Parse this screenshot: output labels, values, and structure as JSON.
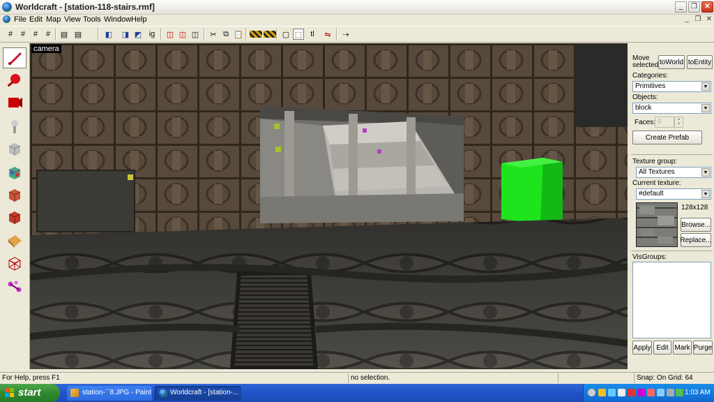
{
  "window": {
    "title": "Worldcraft - [station-118-stairs.rmf]"
  },
  "menu": {
    "items": [
      "File",
      "Edit",
      "Map",
      "View",
      "Tools",
      "Window",
      "Help"
    ]
  },
  "toolbar": {
    "grid_label": "ig",
    "tl_label": "tl"
  },
  "viewport": {
    "label": "camera"
  },
  "right_panel": {
    "move_selected_line1": "Move",
    "move_selected_line2": "selected:",
    "to_world": "toWorld",
    "to_entity": "toEntity",
    "categories_label": "Categories:",
    "categories_value": "Primitives",
    "objects_label": "Objects:",
    "objects_value": "block",
    "faces_label": "Faces:",
    "faces_value": "0",
    "create_prefab": "Create Prefab",
    "texture_group_label": "Texture group:",
    "texture_group_value": "All Textures",
    "current_texture_label": "Current texture:",
    "current_texture_value": "#default",
    "texture_size": "128x128",
    "browse": "Browse...",
    "replace": "Replace...",
    "visgroups_label": "VisGroups:",
    "apply": "Apply",
    "edit": "Edit",
    "mark": "Mark",
    "purge": "Purge"
  },
  "status": {
    "help": "For Help, press F1",
    "selection": "no selection.",
    "snap": "Snap: On Grid: 64"
  },
  "taskbar": {
    "start": "start",
    "items": [
      "station-``8.JPG - Paint",
      "Worldcraft - [station-..."
    ],
    "clock": "1:03 AM"
  },
  "colors": {
    "accent_green": "#22ee22",
    "taskbar_blue": "#2152c8",
    "start_green": "#2f8a2f"
  }
}
